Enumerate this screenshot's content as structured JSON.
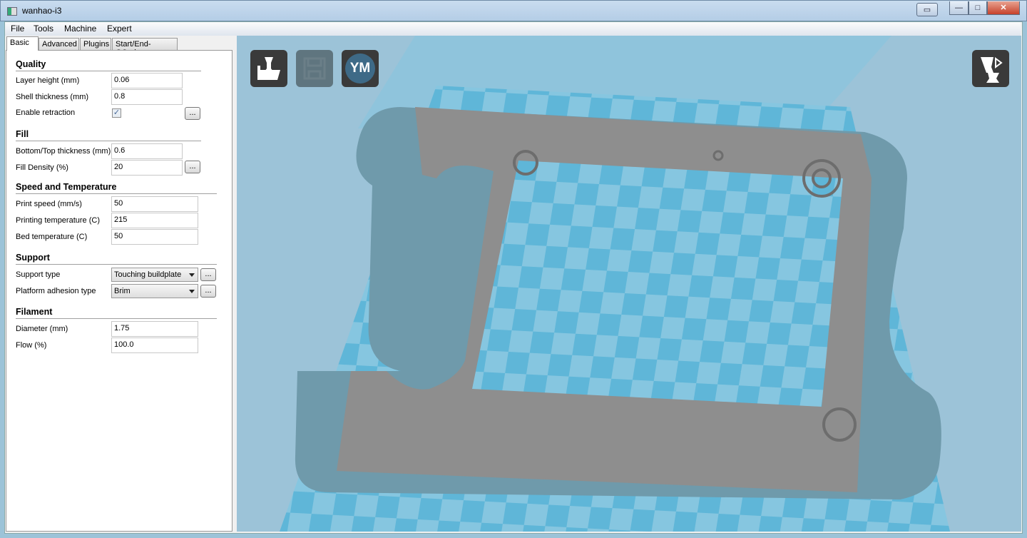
{
  "window": {
    "title": "wanhao-i3",
    "buttons": {
      "restore_special": "▭",
      "minimize": "—",
      "maximize": "□",
      "close": "✕"
    }
  },
  "menu": [
    "File",
    "Tools",
    "Machine",
    "Expert"
  ],
  "tabs": [
    "Basic",
    "Advanced",
    "Plugins",
    "Start/End-GCode"
  ],
  "sections": {
    "quality": {
      "title": "Quality",
      "layer_height": {
        "label": "Layer height (mm)",
        "value": "0.06"
      },
      "shell_thickness": {
        "label": "Shell thickness (mm)",
        "value": "0.8"
      },
      "retraction": {
        "label": "Enable retraction",
        "checked": true,
        "check": "✓"
      }
    },
    "fill": {
      "title": "Fill",
      "bottom_top": {
        "label": "Bottom/Top thickness (mm)",
        "value": "0.6"
      },
      "density": {
        "label": "Fill Density (%)",
        "value": "20"
      }
    },
    "speed": {
      "title": "Speed and Temperature",
      "print_speed": {
        "label": "Print speed (mm/s)",
        "value": "50"
      },
      "print_temp": {
        "label": "Printing temperature (C)",
        "value": "215"
      },
      "bed_temp": {
        "label": "Bed temperature (C)",
        "value": "50"
      }
    },
    "support": {
      "title": "Support",
      "support_type": {
        "label": "Support type",
        "value": "Touching buildplate"
      },
      "adhesion": {
        "label": "Platform adhesion type",
        "value": "Brim"
      }
    },
    "filament": {
      "title": "Filament",
      "diameter": {
        "label": "Diameter (mm)",
        "value": "1.75"
      },
      "flow": {
        "label": "Flow (%)",
        "value": "100.0"
      }
    }
  },
  "more_label": "...",
  "viewport": {
    "ym_label": "YM"
  }
}
